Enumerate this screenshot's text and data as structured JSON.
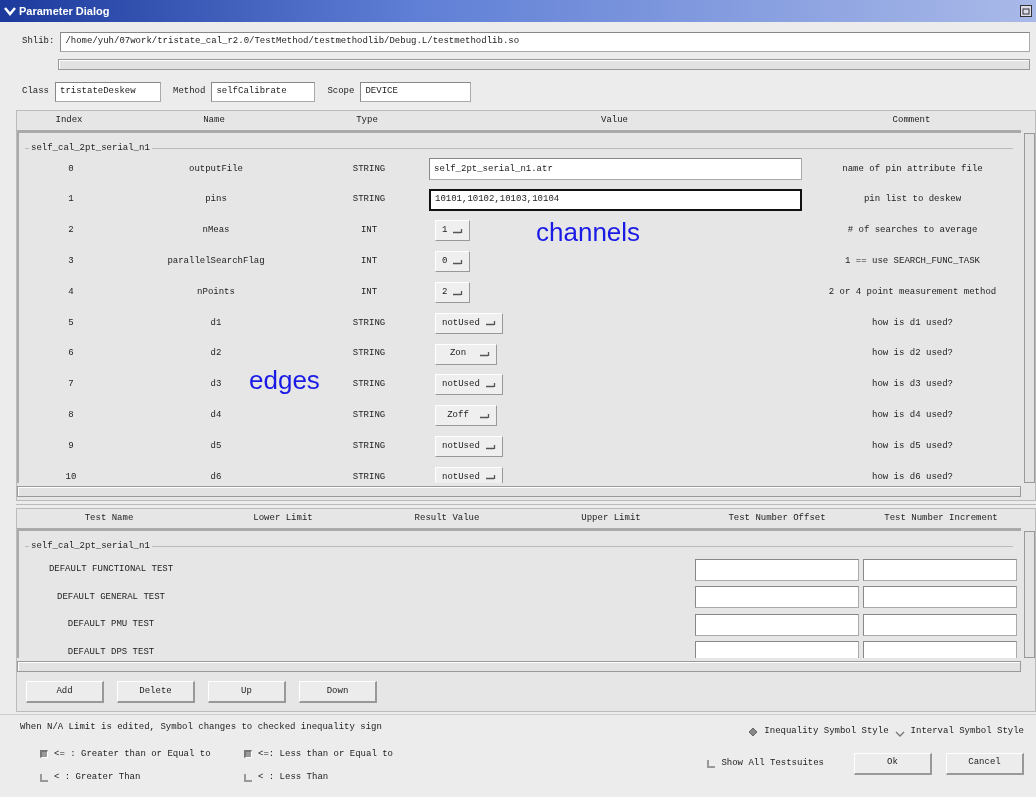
{
  "window": {
    "title": "Parameter Dialog"
  },
  "shlib": {
    "label": "Shlib:",
    "value": "/home/yuh/07work/tristate_cal_r2.0/TestMethod/testmethodlib/Debug.L/testmethodlib.so"
  },
  "identity": [
    {
      "label": "Class",
      "value": "tristateDeskew"
    },
    {
      "label": "Method",
      "value": "selfCalibrate"
    },
    {
      "label": "Scope",
      "value": "DEVICE"
    }
  ],
  "parameters": {
    "columns": [
      "Index",
      "Name",
      "Type",
      "Value",
      "Comment"
    ],
    "group": "self_cal_2pt_serial_n1",
    "rows": [
      {
        "index": "0",
        "name": "outputFile",
        "type": "STRING",
        "kind": "text",
        "value": "self_2pt_serial_n1.atr",
        "focused": false,
        "comment": "name of pin attribute file"
      },
      {
        "index": "1",
        "name": "pins",
        "type": "STRING",
        "kind": "text",
        "value": "10101,10102,10103,10104",
        "focused": true,
        "comment": "pin list to deskew"
      },
      {
        "index": "2",
        "name": "nMeas",
        "type": "INT",
        "kind": "option",
        "value": "1",
        "comment": "# of searches to average"
      },
      {
        "index": "3",
        "name": "parallelSearchFlag",
        "type": "INT",
        "kind": "option",
        "value": "0",
        "comment": "1 == use SEARCH_FUNC_TASK"
      },
      {
        "index": "4",
        "name": "nPoints",
        "type": "INT",
        "kind": "option",
        "value": "2",
        "comment": "2 or 4 point measurement method"
      },
      {
        "index": "5",
        "name": "d1",
        "type": "STRING",
        "kind": "option",
        "value": "notUsed",
        "comment": "how is d1 used?"
      },
      {
        "index": "6",
        "name": "d2",
        "type": "STRING",
        "kind": "option",
        "value": "Zon",
        "comment": "how is d2 used?"
      },
      {
        "index": "7",
        "name": "d3",
        "type": "STRING",
        "kind": "option",
        "value": "notUsed",
        "comment": "how is d3 used?"
      },
      {
        "index": "8",
        "name": "d4",
        "type": "STRING",
        "kind": "option",
        "value": "Zoff",
        "comment": "how is d4 used?"
      },
      {
        "index": "9",
        "name": "d5",
        "type": "STRING",
        "kind": "option",
        "value": "notUsed",
        "comment": "how is d5 used?"
      },
      {
        "index": "10",
        "name": "d6",
        "type": "STRING",
        "kind": "option",
        "value": "notUsed",
        "comment": "how is d6 used?"
      }
    ]
  },
  "annotations": [
    {
      "text": "channels"
    },
    {
      "text": "edges"
    }
  ],
  "tests": {
    "columns": [
      "Test Name",
      "Lower Limit",
      "Result Value",
      "Upper Limit",
      "Test Number Offset",
      "Test Number Increment"
    ],
    "group": "self_cal_2pt_serial_n1",
    "rows": [
      {
        "name": "DEFAULT FUNCTIONAL TEST"
      },
      {
        "name": "DEFAULT GENERAL TEST"
      },
      {
        "name": "DEFAULT PMU TEST"
      },
      {
        "name": "DEFAULT DPS TEST"
      }
    ]
  },
  "buttons": [
    "Add",
    "Delete",
    "Up",
    "Down"
  ],
  "note": "When N/A Limit is edited, Symbol changes to checked inequality sign",
  "limit_options": [
    {
      "label": "<= : Greater than or Equal to",
      "checked": true
    },
    {
      "label": "<=: Less than or Equal to",
      "checked": true
    },
    {
      "label": "< : Greater Than",
      "checked": false
    },
    {
      "label": "< : Less Than",
      "checked": false
    }
  ],
  "symbol_styles": [
    {
      "label": "Inequality Symbol Style",
      "selected": true
    },
    {
      "label": "Interval Symbol Style",
      "selected": false
    }
  ],
  "show_all": {
    "label": "Show All Testsuites",
    "checked": false
  },
  "dialog_buttons": [
    "Ok",
    "Cancel"
  ]
}
